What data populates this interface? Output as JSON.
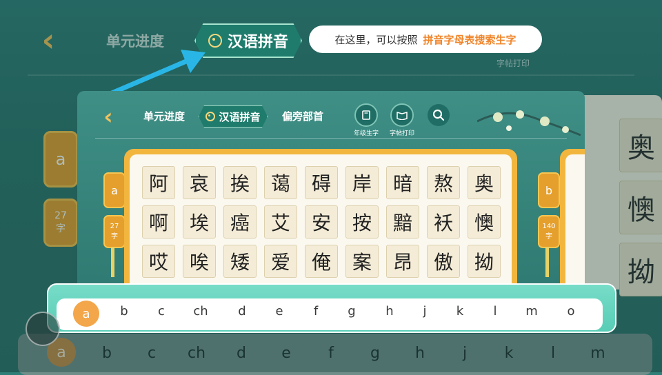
{
  "background": {
    "tabs": {
      "progress": "单元进度",
      "print": "字帖打印"
    },
    "left_tag": {
      "letter": "a",
      "count": "27",
      "unit": "字"
    },
    "right_chars": [
      "奥",
      "懊",
      "拗"
    ],
    "keyboard": [
      "a",
      "b",
      "c",
      "ch",
      "d",
      "e",
      "f",
      "g",
      "h",
      "j",
      "k",
      "l",
      "m"
    ]
  },
  "callout": {
    "tab_label": "汉语拼音",
    "tooltip_prefix": "在这里，可以按照",
    "tooltip_highlight": "拼音字母表搜索生字"
  },
  "panel": {
    "tabs": {
      "progress": "单元进度",
      "pinyin": "汉语拼音",
      "radicals": "偏旁部首"
    },
    "tools": [
      {
        "label": "年级生字",
        "icon": "book-icon"
      },
      {
        "label": "字帖打印",
        "icon": "copybook-icon"
      }
    ],
    "search_icon": "search-icon",
    "group_a": {
      "letter": "a",
      "count": "27",
      "unit": "字"
    },
    "group_b": {
      "letter": "b",
      "count": "140",
      "unit": "字"
    },
    "characters": [
      [
        "阿",
        "哀",
        "挨",
        "蔼",
        "碍",
        "岸",
        "暗",
        "熬",
        "奥"
      ],
      [
        "啊",
        "埃",
        "癌",
        "艾",
        "安",
        "按",
        "黯",
        "袄",
        "懊"
      ],
      [
        "哎",
        "唉",
        "矮",
        "爱",
        "俺",
        "案",
        "昂",
        "傲",
        "拗"
      ]
    ]
  },
  "letter_bar": {
    "active": "a",
    "letters": [
      "a",
      "b",
      "c",
      "ch",
      "d",
      "e",
      "f",
      "g",
      "h",
      "j",
      "k",
      "l",
      "m",
      "o"
    ]
  },
  "colors": {
    "accent_orange": "#f3a64a",
    "teal": "#1f7c6c",
    "highlight_text": "#f0852b"
  }
}
